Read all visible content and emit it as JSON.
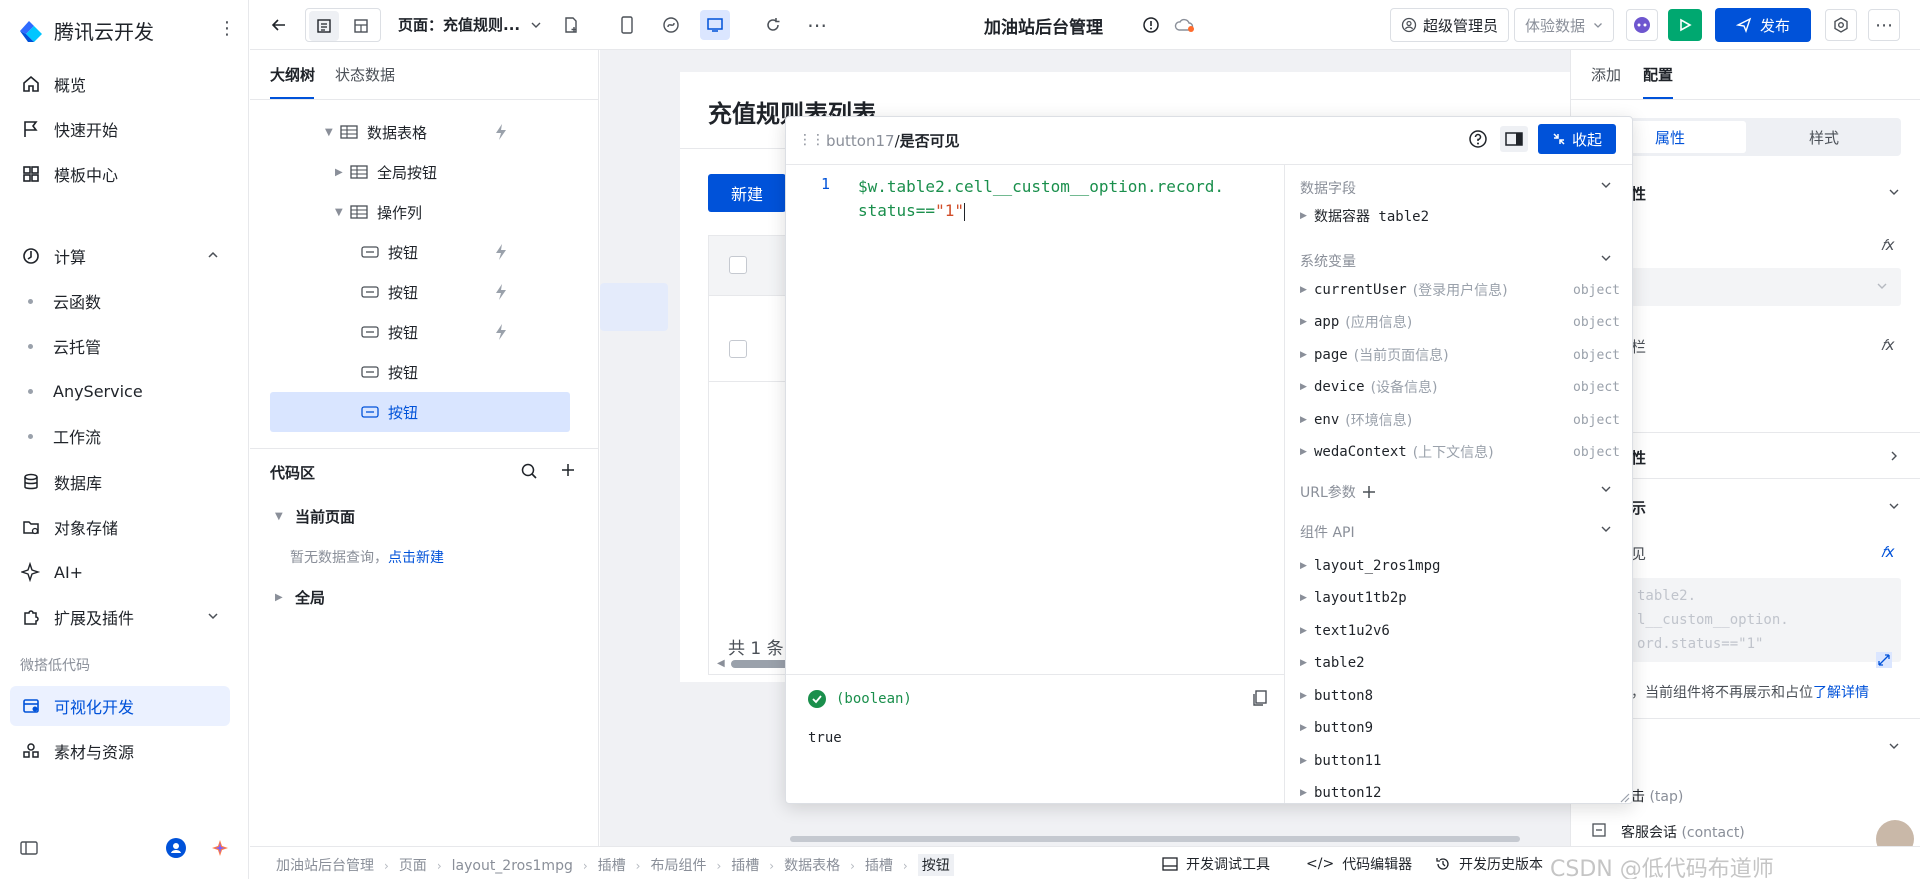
{
  "app": {
    "brand": "腾讯云开发"
  },
  "leftnav": {
    "items": [
      {
        "label": "概览",
        "icon": "home-icon"
      },
      {
        "label": "快速开始",
        "icon": "flag-icon"
      },
      {
        "label": "模板中心",
        "icon": "grid-icon"
      }
    ],
    "compute": {
      "label": "计算",
      "subs": [
        "云函数",
        "云托管",
        "AnyService",
        "工作流"
      ]
    },
    "more": [
      {
        "label": "数据库",
        "icon": "database-icon"
      },
      {
        "label": "对象存储",
        "icon": "folder-icon"
      },
      {
        "label": "AI+",
        "icon": "sparkle-icon"
      },
      {
        "label": "扩展及插件",
        "icon": "puzzle-icon"
      }
    ],
    "section": "微搭低代码",
    "lowcode": [
      {
        "label": "可视化开发",
        "icon": "canvas-icon"
      },
      {
        "label": "素材与资源",
        "icon": "assets-icon"
      }
    ]
  },
  "topbar": {
    "page_label": "页面：充值规则...",
    "project_title": "加油站后台管理",
    "role": "超级管理员",
    "data_mode": "体验数据",
    "publish": "发布"
  },
  "outline": {
    "tabs": [
      "大纲树",
      "状态数据"
    ],
    "tree": [
      "数据表格",
      "全局按钮",
      "操作列",
      "按钮",
      "按钮",
      "按钮",
      "按钮",
      "按钮"
    ],
    "code_title": "代码区",
    "current_page": "当前页面",
    "empty_hint": "暂无数据查询，",
    "create_link": "点击新建",
    "global": "全局"
  },
  "canvas": {
    "page_title": "充值规则表列表",
    "new_button": "新建",
    "footer_text": "共 1 条"
  },
  "popup": {
    "path_component": "button17",
    "path_sep": "/",
    "path_prop": "是否可见",
    "collapse": "收起",
    "line_no": "1",
    "code_line1": "$w.table2.cell__custom__option.record.",
    "code_line2a": "status==",
    "code_line2b": "\"1\"",
    "result_type": "(boolean)",
    "result_value": "true",
    "sections": {
      "data_fields": "数据字段",
      "data_container": "数据容器 table2",
      "system_vars": "系统变量",
      "url_params": "URL参数",
      "component_api": "组件 API"
    },
    "system_vars": [
      {
        "name": "currentUser",
        "desc": "(登录用户信息)",
        "type": "object"
      },
      {
        "name": "app",
        "desc": "(应用信息)",
        "type": "object"
      },
      {
        "name": "page",
        "desc": "(当前页面信息)",
        "type": "object"
      },
      {
        "name": "device",
        "desc": "(设备信息)",
        "type": "object"
      },
      {
        "name": "env",
        "desc": "(环境信息)",
        "type": "object"
      },
      {
        "name": "wedaContext",
        "desc": "(上下文信息)",
        "type": "object"
      }
    ],
    "components": [
      "layout_2ros1mpg",
      "layout1tb2p",
      "text1u2v6",
      "table2",
      "button8",
      "button9",
      "button11",
      "button12"
    ]
  },
  "config": {
    "tabs": [
      "添加",
      "配置"
    ],
    "seg": [
      "属性",
      "样式"
    ],
    "rows": [
      "性",
      "栏",
      "性",
      "示",
      "见"
    ],
    "code_preview": [
      "table2.",
      "l__custom__option.",
      "ord.status==\"1\""
    ],
    "hint": "，当前组件将不再展示和占位",
    "hint_link": "了解详情",
    "event_tap": "击",
    "event_tap_code": "(tap)",
    "event_contact": "客服会话",
    "event_contact_code": "(contact)"
  },
  "bottombar": {
    "crumbs": [
      "加油站后台管理",
      "页面",
      "layout_2ros1mpg",
      "插槽",
      "布局组件",
      "插槽",
      "数据表格",
      "插槽",
      "按钮"
    ],
    "tools": [
      "开发调试工具",
      "代码编辑器",
      "开发历史版本"
    ],
    "watermark": "CSDN @低代码布道师"
  },
  "colors": {
    "primary": "#0052d9",
    "green": "#00a870",
    "code_green": "#1a8f4c",
    "string_red": "#d14d29"
  }
}
